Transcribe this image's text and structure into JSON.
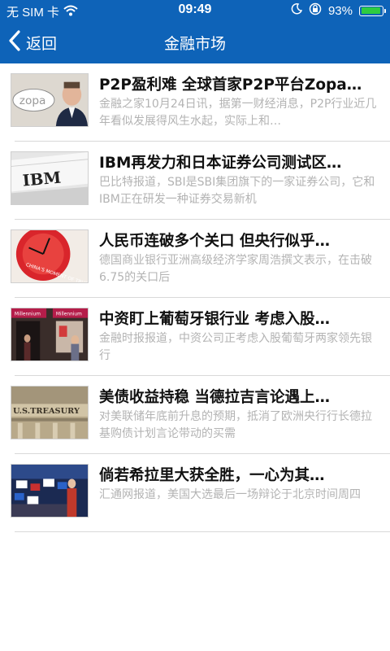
{
  "status_bar": {
    "carrier": "无 SIM 卡",
    "time": "09:49",
    "battery": "93%",
    "battery_level": 0.93,
    "icons": [
      "wifi-icon",
      "moon-icon",
      "rotation-lock-icon",
      "battery-icon"
    ]
  },
  "nav": {
    "back_label": "返回",
    "title": "金融市场",
    "back_icon": "chevron-left-icon"
  },
  "colors": {
    "accent": "#0e63b8",
    "title_text": "#111111",
    "summary_text": "#b3b3b3",
    "divider": "#d9d9d9"
  },
  "news": [
    {
      "title": "P2P盈利难 全球首家P2P平台Zopa…",
      "summary": "金融之家10月24日讯，据第一财经消息，P2P行业近几年看似发展得风生水起，实际上和…",
      "thumb": "zopa-photo",
      "thumb_text": "zopa"
    },
    {
      "title": "IBM再发力和日本证券公司测试区…",
      "summary": "巴比特报道，SBI是SBI集团旗下的一家证券公司，它和IBM正在研发一种证券交易新机",
      "thumb": "ibm-photo",
      "thumb_text": "IBM"
    },
    {
      "title": "人民币连破多个关口 但央行似乎…",
      "summary": "德国商业银行亚洲高级经济学家周浩撰文表示，在击破6.75的关口后",
      "thumb": "yuan-clock-photo",
      "thumb_text": "CHINA'S MOMENT OF TRUTH"
    },
    {
      "title": "中资盯上葡萄牙银行业 考虑入股…",
      "summary": "金融时报报道，中资公司正考虑入股葡萄牙两家领先银行",
      "thumb": "millennium-bank-photo",
      "thumb_text": "Millennium"
    },
    {
      "title": "美债收益持稳 当德拉吉言论遇上…",
      "summary": "对美联储年底前升息的预期，抵消了欧洲央行行长德拉基购债计划言论带动的买需",
      "thumb": "us-treasury-photo",
      "thumb_text": "U.S.TREASURY"
    },
    {
      "title": "倘若希拉里大获全胜，一心为其…",
      "summary": "汇通网报道，美国大选最后一场辩论于北京时间周四",
      "thumb": "rally-photo",
      "thumb_text": ""
    }
  ]
}
